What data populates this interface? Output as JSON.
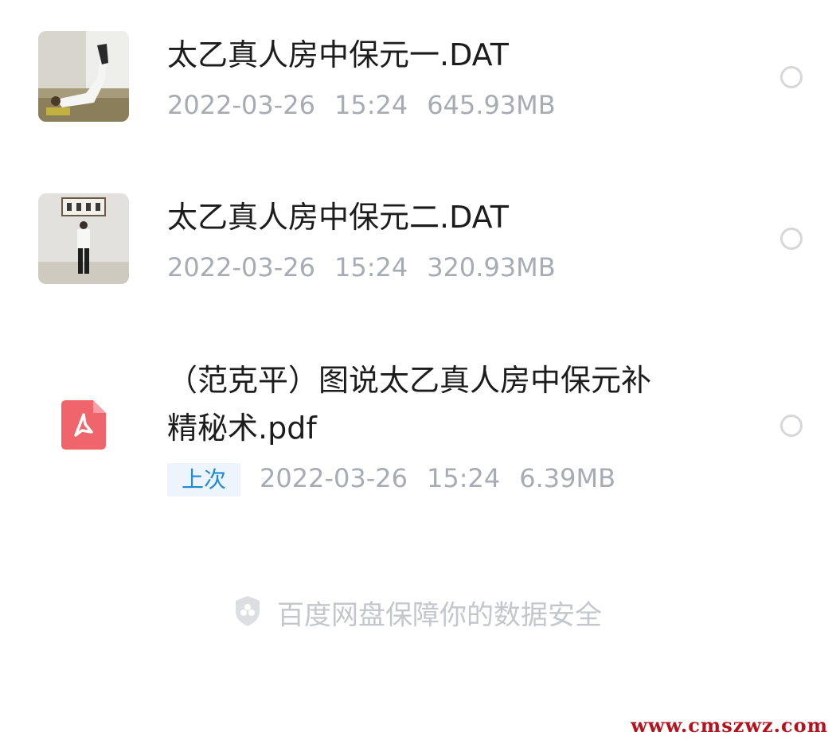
{
  "files": [
    {
      "name": "太乙真人房中保元一.DAT",
      "date": "2022-03-26",
      "time": "15:24",
      "size": "645.93MB",
      "thumbnail": "video-thumbnail"
    },
    {
      "name": "太乙真人房中保元二.DAT",
      "date": "2022-03-26",
      "time": "15:24",
      "size": "320.93MB",
      "thumbnail": "video-thumbnail"
    },
    {
      "name_line1": "（范克平）图说太乙真人房中保元补",
      "name_line2": "精秘术.pdf",
      "badge": "上次",
      "date": "2022-03-26",
      "time": "15:24",
      "size": "6.39MB",
      "icon": "pdf-icon"
    }
  ],
  "footer": {
    "text": "百度网盘保障你的数据安全",
    "icon": "shield-icon"
  },
  "watermark": "www.cmszwz.com",
  "colors": {
    "pdf_icon": "#f0656b",
    "badge_text": "#1f8bd8",
    "badge_bg": "#eef4fb",
    "meta_text": "#a6abb4",
    "watermark": "#b4121c"
  }
}
